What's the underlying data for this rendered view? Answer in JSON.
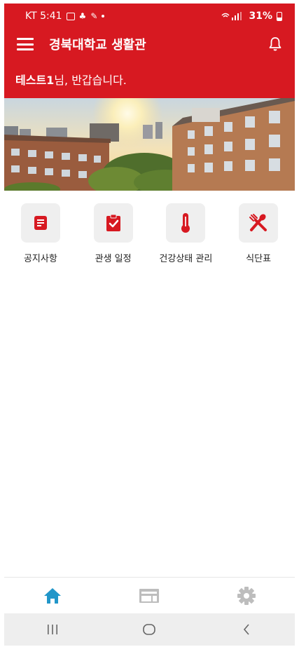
{
  "status_bar": {
    "carrier_time": "KT 5:41",
    "battery": "31%"
  },
  "app_bar": {
    "title": "경북대학교 생활관"
  },
  "greeting": {
    "name": "테스트1",
    "suffix": "님, 반갑습니다."
  },
  "menu": [
    {
      "label": "공지사항",
      "icon": "notice-icon"
    },
    {
      "label": "관생 일정",
      "icon": "clipboard-check-icon"
    },
    {
      "label": "건강상태 관리",
      "icon": "thermometer-icon"
    },
    {
      "label": "식단표",
      "icon": "utensils-icon"
    }
  ],
  "bottom_nav": [
    {
      "icon": "home-icon",
      "active": true
    },
    {
      "icon": "board-icon",
      "active": false
    },
    {
      "icon": "settings-icon",
      "active": false
    }
  ],
  "colors": {
    "brand_red": "#d71921",
    "active_nav": "#2196c9",
    "inactive_nav": "#bdbdbd"
  }
}
